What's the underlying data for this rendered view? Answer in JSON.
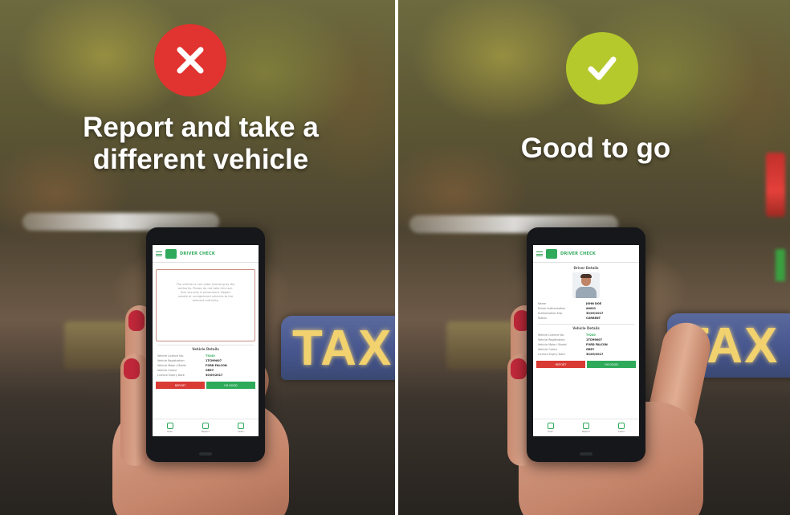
{
  "panels": [
    {
      "id": "reject",
      "status_icon": "close-icon",
      "status_color": "#e1332f",
      "headline_lines": [
        "Report and take a",
        "different vehicle"
      ],
      "taxi_sign": "TAX",
      "phone": {
        "app_title": "DRIVER CHECK",
        "warning_lines": [
          "The vehicle is not under licensing by the",
          "authority. Please do not take this taxi.",
          "Your security is paramount. Report",
          "unsafe or unregistered vehicles to the",
          "relevant authority."
        ],
        "vehicle_title": "Vehicle Details",
        "vehicle_rows": [
          {
            "k": "Vehicle Licence No.",
            "v": "T9240"
          },
          {
            "k": "Vehicle Registration",
            "v": "1TCM9007"
          },
          {
            "k": "Vehicle Make / Model",
            "v": "FORD FALCON"
          },
          {
            "k": "Vehicle Colour",
            "v": "GREY"
          },
          {
            "k": "Licence Expiry Date",
            "v": "30/09/2017"
          }
        ],
        "buttons": {
          "report": "REPORT",
          "go": "I'M GOOD"
        },
        "nav": [
          "Scan",
          "Report",
          "Learn"
        ]
      }
    },
    {
      "id": "accept",
      "status_icon": "check-icon",
      "status_color": "#b5c92c",
      "headline_lines": [
        "Good to go"
      ],
      "taxi_sign": "TAX",
      "phone": {
        "app_title": "DRIVER CHECK",
        "driver_title": "Driver Details",
        "driver_rows": [
          {
            "k": "Name",
            "v": "JOHN DOE"
          },
          {
            "k": "Driver Authorisation",
            "v": "A0001"
          },
          {
            "k": "Authorisation Exp.",
            "v": "30/09/2017"
          },
          {
            "k": "Status",
            "v": "CURRENT"
          }
        ],
        "vehicle_title": "Vehicle Details",
        "vehicle_rows": [
          {
            "k": "Vehicle Licence No.",
            "v": "T9240"
          },
          {
            "k": "Vehicle Registration",
            "v": "1TCM9007"
          },
          {
            "k": "Vehicle Make / Model",
            "v": "FORD FALCON"
          },
          {
            "k": "Vehicle Colour",
            "v": "GREY"
          },
          {
            "k": "Licence Expiry Date",
            "v": "30/09/2017"
          }
        ],
        "buttons": {
          "report": "REPORT",
          "go": "I'M GOOD"
        },
        "nav": [
          "Scan",
          "Report",
          "Learn"
        ]
      }
    }
  ]
}
